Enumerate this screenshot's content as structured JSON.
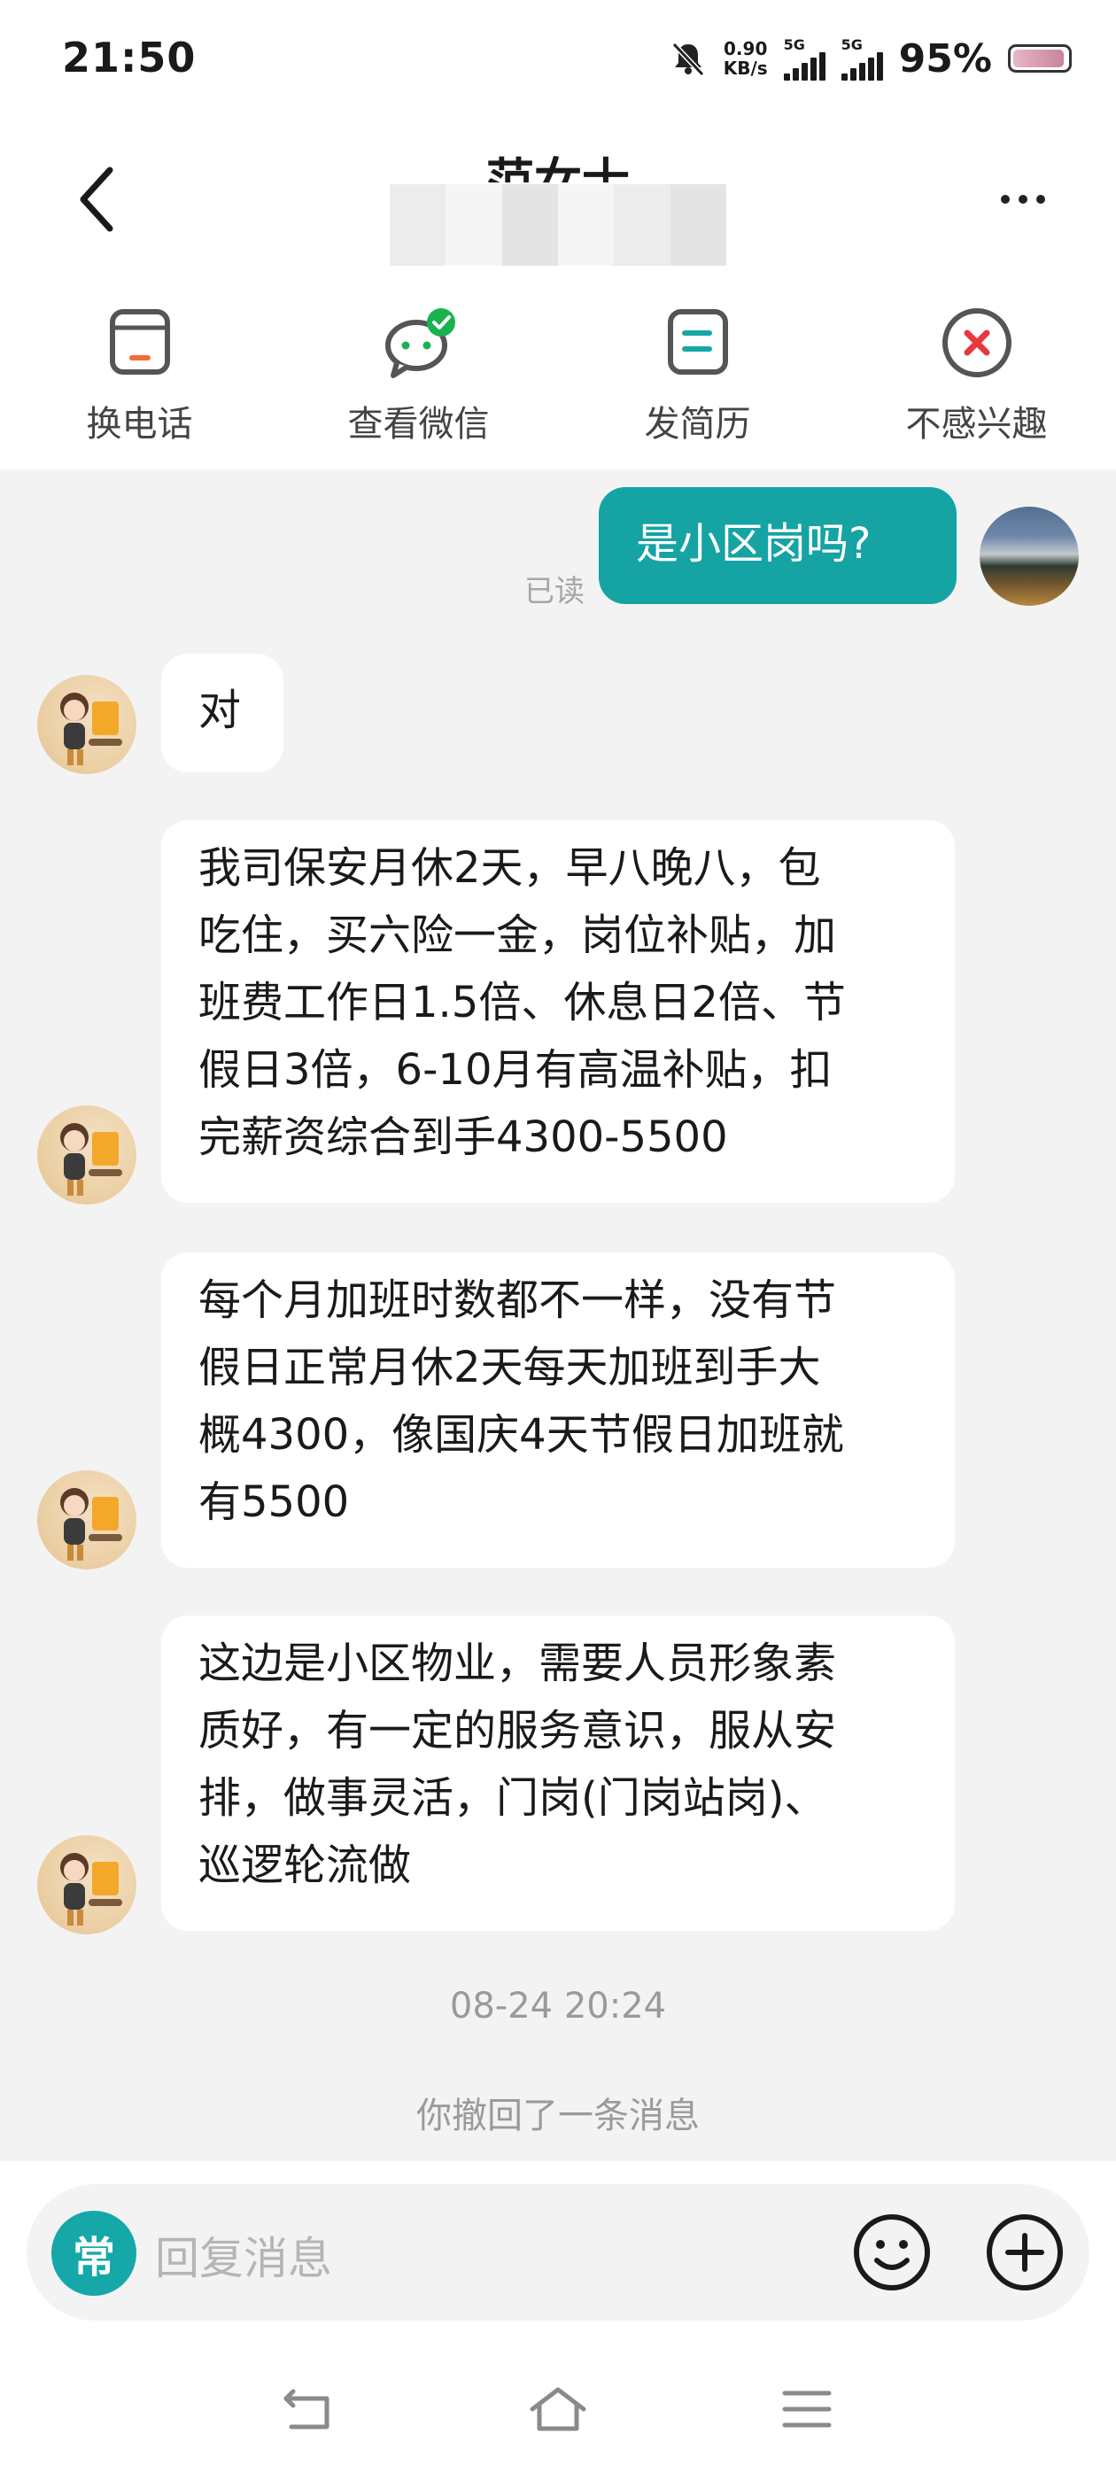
{
  "status_bar": {
    "time": "21:50",
    "net_speed_value": "0.90",
    "net_speed_unit": "KB/s",
    "signal1_label": "5G",
    "signal2_label": "5G",
    "battery": "95%"
  },
  "header": {
    "contact_name": "范女士"
  },
  "actions": [
    {
      "label": "换电话",
      "icon": "phone-card-icon"
    },
    {
      "label": "查看微信",
      "icon": "wechat-icon"
    },
    {
      "label": "发简历",
      "icon": "resume-icon"
    },
    {
      "label": "不感兴趣",
      "icon": "not-interested-icon"
    }
  ],
  "messages": [
    {
      "direction": "out",
      "text": "是小区岗吗?",
      "status": "已读"
    },
    {
      "direction": "in",
      "text": "对"
    },
    {
      "direction": "in",
      "text": "我司保安月休2天，早八晚八，包\n吃住，买六险一金，岗位补贴，加\n班费工作日1.5倍、休息日2倍、节\n假日3倍，6-10月有高温补贴，扣\n完薪资综合到手4300-5500"
    },
    {
      "direction": "in",
      "text": "每个月加班时数都不一样，没有节\n假日正常月休2天每天加班到手大\n概4300，像国庆4天节假日加班就\n有5500"
    },
    {
      "direction": "in",
      "text": "这边是小区物业，需要人员形象素\n质好，有一定的服务意识，服从安\n排，做事灵活，门岗(门岗站岗)、\n巡逻轮流做"
    }
  ],
  "timestamp": "08-24 20:24",
  "system_notice": "你撤回了一条消息",
  "input": {
    "quick_label": "常",
    "placeholder": "回复消息"
  },
  "colors": {
    "accent": "#16a3a3",
    "chat_bg": "#f3f3f3",
    "incoming_bubble": "#ffffff"
  }
}
